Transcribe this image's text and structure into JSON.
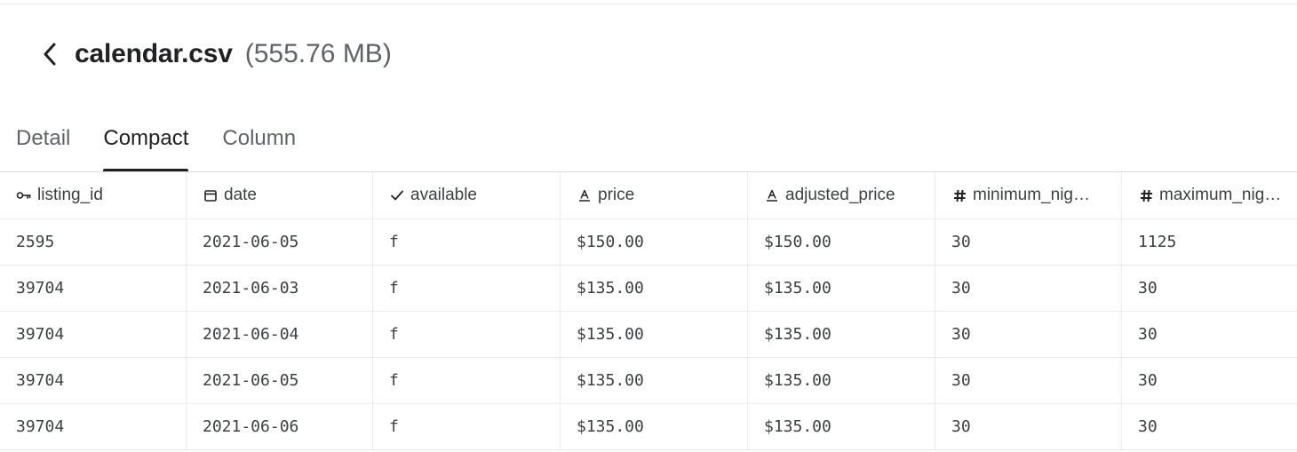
{
  "header": {
    "title": "calendar.csv",
    "size": "(555.76 MB)"
  },
  "tabs": [
    {
      "label": "Detail",
      "active": false
    },
    {
      "label": "Compact",
      "active": true
    },
    {
      "label": "Column",
      "active": false
    }
  ],
  "table": {
    "columns": [
      {
        "label": "listing_id",
        "icon": "key-icon"
      },
      {
        "label": "date",
        "icon": "calendar-icon"
      },
      {
        "label": "available",
        "icon": "check-icon"
      },
      {
        "label": "price",
        "icon": "string-type-icon"
      },
      {
        "label": "adjusted_price",
        "icon": "string-type-icon"
      },
      {
        "label": "minimum_nig…",
        "icon": "hash-icon"
      },
      {
        "label": "maximum_nig…",
        "icon": "hash-icon"
      }
    ],
    "rows": [
      [
        "2595",
        "2021-06-05",
        "f",
        "$150.00",
        "$150.00",
        "30",
        "1125"
      ],
      [
        "39704",
        "2021-06-03",
        "f",
        "$135.00",
        "$135.00",
        "30",
        "30"
      ],
      [
        "39704",
        "2021-06-04",
        "f",
        "$135.00",
        "$135.00",
        "30",
        "30"
      ],
      [
        "39704",
        "2021-06-05",
        "f",
        "$135.00",
        "$135.00",
        "30",
        "30"
      ],
      [
        "39704",
        "2021-06-06",
        "f",
        "$135.00",
        "$135.00",
        "30",
        "30"
      ]
    ]
  }
}
